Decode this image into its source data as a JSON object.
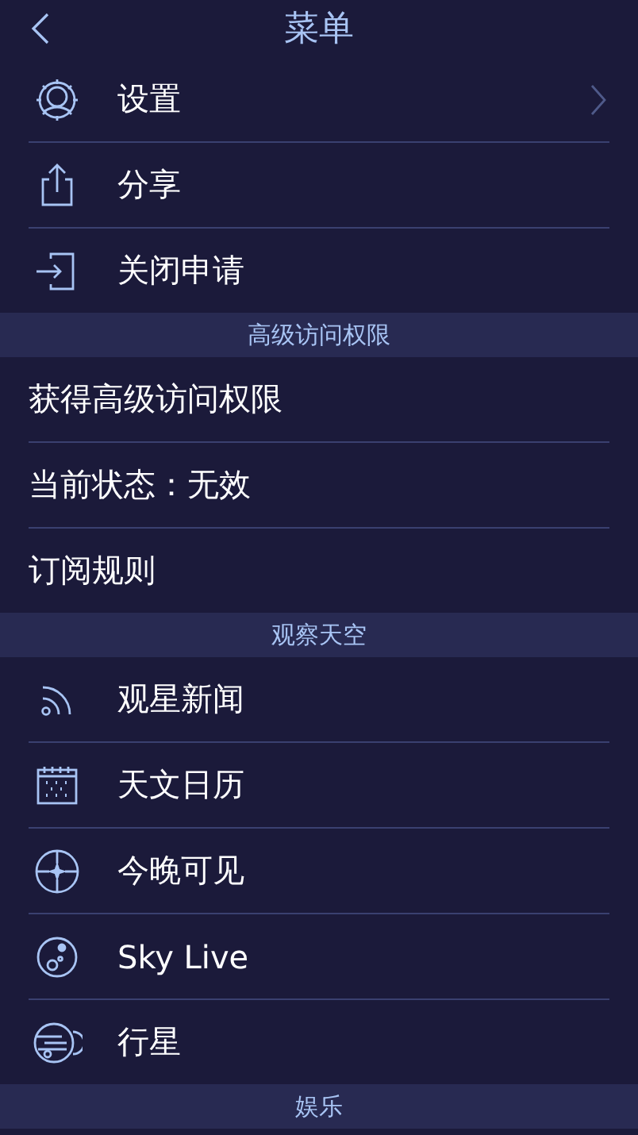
{
  "header": {
    "title": "菜单"
  },
  "sections": [
    {
      "items": [
        {
          "label": "设置",
          "kind": "gear",
          "chevron": true
        },
        {
          "label": "分享",
          "kind": "share",
          "chevron": false
        },
        {
          "label": "关闭申请",
          "kind": "exit",
          "chevron": false
        }
      ]
    },
    {
      "title": "高级访问权限",
      "items": [
        {
          "label": "获得高级访问权限",
          "kind": "plain",
          "chevron": false
        },
        {
          "label": "当前状态：无效",
          "kind": "plain",
          "chevron": false
        },
        {
          "label": "订阅规则",
          "kind": "plain",
          "chevron": false
        }
      ]
    },
    {
      "title": "观察天空",
      "items": [
        {
          "label": "观星新闻",
          "kind": "feed",
          "chevron": false
        },
        {
          "label": "天文日历",
          "kind": "calendar",
          "chevron": false
        },
        {
          "label": "今晚可见",
          "kind": "crosshair",
          "chevron": false
        },
        {
          "label": "Sky Live",
          "kind": "moon",
          "chevron": false
        },
        {
          "label": "行星",
          "kind": "planet",
          "chevron": false
        }
      ]
    },
    {
      "title": "娱乐"
    }
  ]
}
